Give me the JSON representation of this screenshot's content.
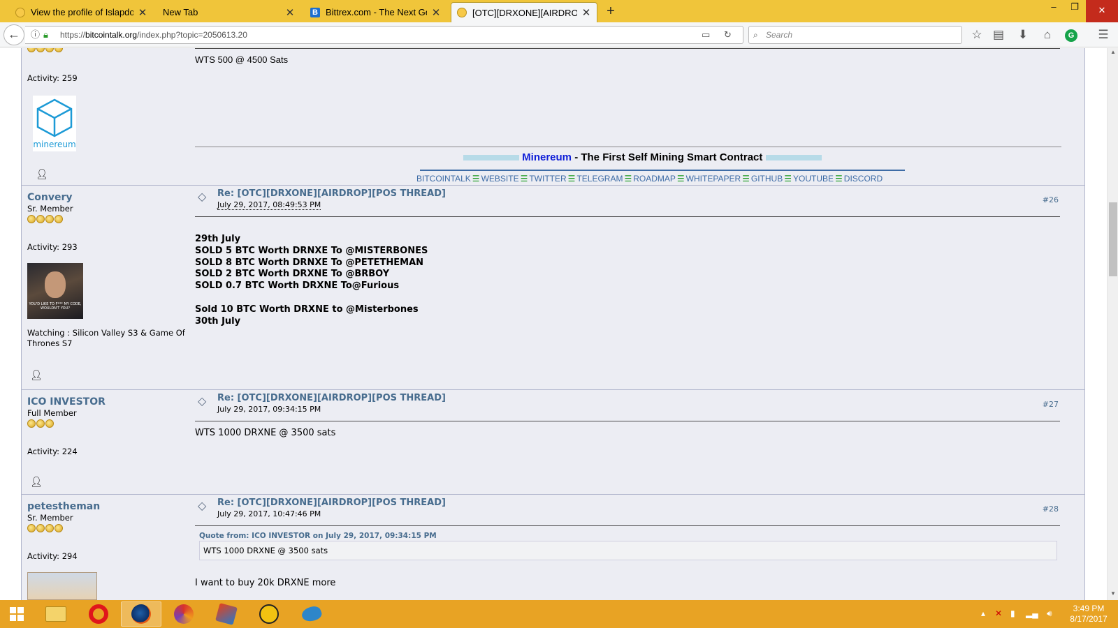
{
  "browser": {
    "tabs": [
      {
        "title": "View the profile of Islapdonk",
        "favicon": "bitcoin-favicon",
        "active": false
      },
      {
        "title": "New Tab",
        "favicon": "none",
        "active": false
      },
      {
        "title": "Bittrex.com - The Next Gene",
        "favicon": "bittrex-favicon",
        "active": false
      },
      {
        "title": "[OTC][DRXONE][AIRDROP][",
        "favicon": "bitcoin-favicon",
        "active": true
      }
    ],
    "new_tab": "+",
    "window": {
      "minimize": "–",
      "restore": "❐",
      "close": "✕"
    },
    "url_scheme_path_prefix": "https://",
    "url_host": "bitcointalk.org",
    "url_rest": "/index.php?topic=2050613.20",
    "search_placeholder": "Search"
  },
  "sig_top": {
    "activity": "Activity: 259",
    "post_body": "WTS 500 @ 4500 Sats",
    "logo_text": "minereum",
    "brand": "Minereum",
    "tagline": " - The First Self Mining Smart Contract",
    "links": [
      "BITCOINTALK",
      "WEBSITE",
      "TWITTER",
      "TELEGRAM",
      "ROADMAP",
      "WHITEPAPER",
      "GITHUB",
      "YOUTUBE",
      "DISCORD"
    ],
    "sep": "☰"
  },
  "posts": [
    {
      "username": "Convery",
      "rank": "Sr. Member",
      "stars": 4,
      "activity": "Activity: 293",
      "subject": "Re: [OTC][DRXONE][AIRDROP][POS THREAD]",
      "date": "July 29, 2017, 08:49:53 PM",
      "number": "#26",
      "lines": [
        "29th July",
        "SOLD 5 BTC Worth DRNXE To @MISTERBONES",
        "SOLD 8 BTC Worth DRNXE To @PETETHEMAN",
        "SOLD 2 BTC Worth DRXNE To @BRBOY",
        "SOLD 0.7 BTC Worth DRXNE To@Furious",
        "",
        "Sold 10 BTC Worth DRXNE to @Misterbones",
        "30th July"
      ],
      "watching": "Watching : Silicon Valley S3 & Game Of Thrones S7",
      "avatar_caption": "YOU'D LIKE TO F*** MY CODE, WOULDN'T YOU?"
    },
    {
      "username": "ICO INVESTOR",
      "rank": "Full Member",
      "stars": 3,
      "activity": "Activity: 224",
      "subject": "Re: [OTC][DRXONE][AIRDROP][POS THREAD]",
      "date": "July 29, 2017, 09:34:15 PM",
      "number": "#27",
      "body": "WTS  1000 DRXNE @ 3500 sats"
    },
    {
      "username": "petestheman",
      "rank": "Sr. Member",
      "stars": 4,
      "activity": "Activity: 294",
      "subject": "Re: [OTC][DRXONE][AIRDROP][POS THREAD]",
      "date": "July 29, 2017, 10:47:46 PM",
      "number": "#28",
      "quote_header": "Quote from: ICO INVESTOR on July 29, 2017, 09:34:15 PM",
      "quote_body": "WTS  1000 DRXNE @ 3500 sats",
      "body": "I want to buy 20k DRXNE more"
    }
  ],
  "taskbar": {
    "clock_time": "3:49 PM",
    "clock_date": "8/17/2017"
  },
  "colors": {
    "link": "#476c8e",
    "brand_blue": "#0f1fd8",
    "taskbar": "#e8a324",
    "tabbar": "#f0c53a"
  }
}
